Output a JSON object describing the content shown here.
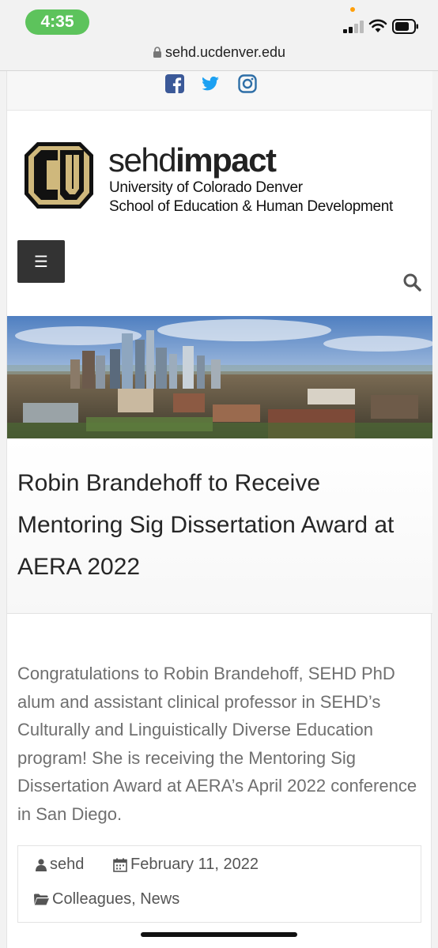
{
  "status_bar": {
    "time": "4:35"
  },
  "browser": {
    "url": "sehd.ucdenver.edu"
  },
  "social": [
    "facebook",
    "twitter",
    "instagram"
  ],
  "header": {
    "brand_light": "sehd",
    "brand_bold": "impact",
    "line1": "University of Colorado Denver",
    "line2": "School of Education & Human Development",
    "menu_glyph": "☰"
  },
  "colors": {
    "gold": "#cfb87c",
    "menu_bg": "#333333",
    "time_pill": "#5dc35c",
    "facebook": "#3b5998",
    "twitter": "#1da1f2",
    "instagram": "#2f6fa7"
  },
  "article": {
    "title": "Robin Brandehoff to Receive Mentoring Sig Dissertation Award at AERA 2022",
    "body": "Congratulations to Robin Brandehoff, SEHD PhD alum and assistant clinical professor in SEHD’s Culturally and Linguistically Diverse Education program! She is receiving the Mentoring Sig Dissertation Award at AERA’s April 2022 conference in San Diego.",
    "author": "sehd",
    "date": "February 11, 2022",
    "categories": [
      "Colleagues",
      "News"
    ]
  },
  "icons": [
    "lock-icon",
    "facebook-icon",
    "twitter-icon",
    "instagram-icon",
    "menu-icon",
    "search-icon",
    "user-icon",
    "calendar-icon",
    "folder-icon"
  ]
}
